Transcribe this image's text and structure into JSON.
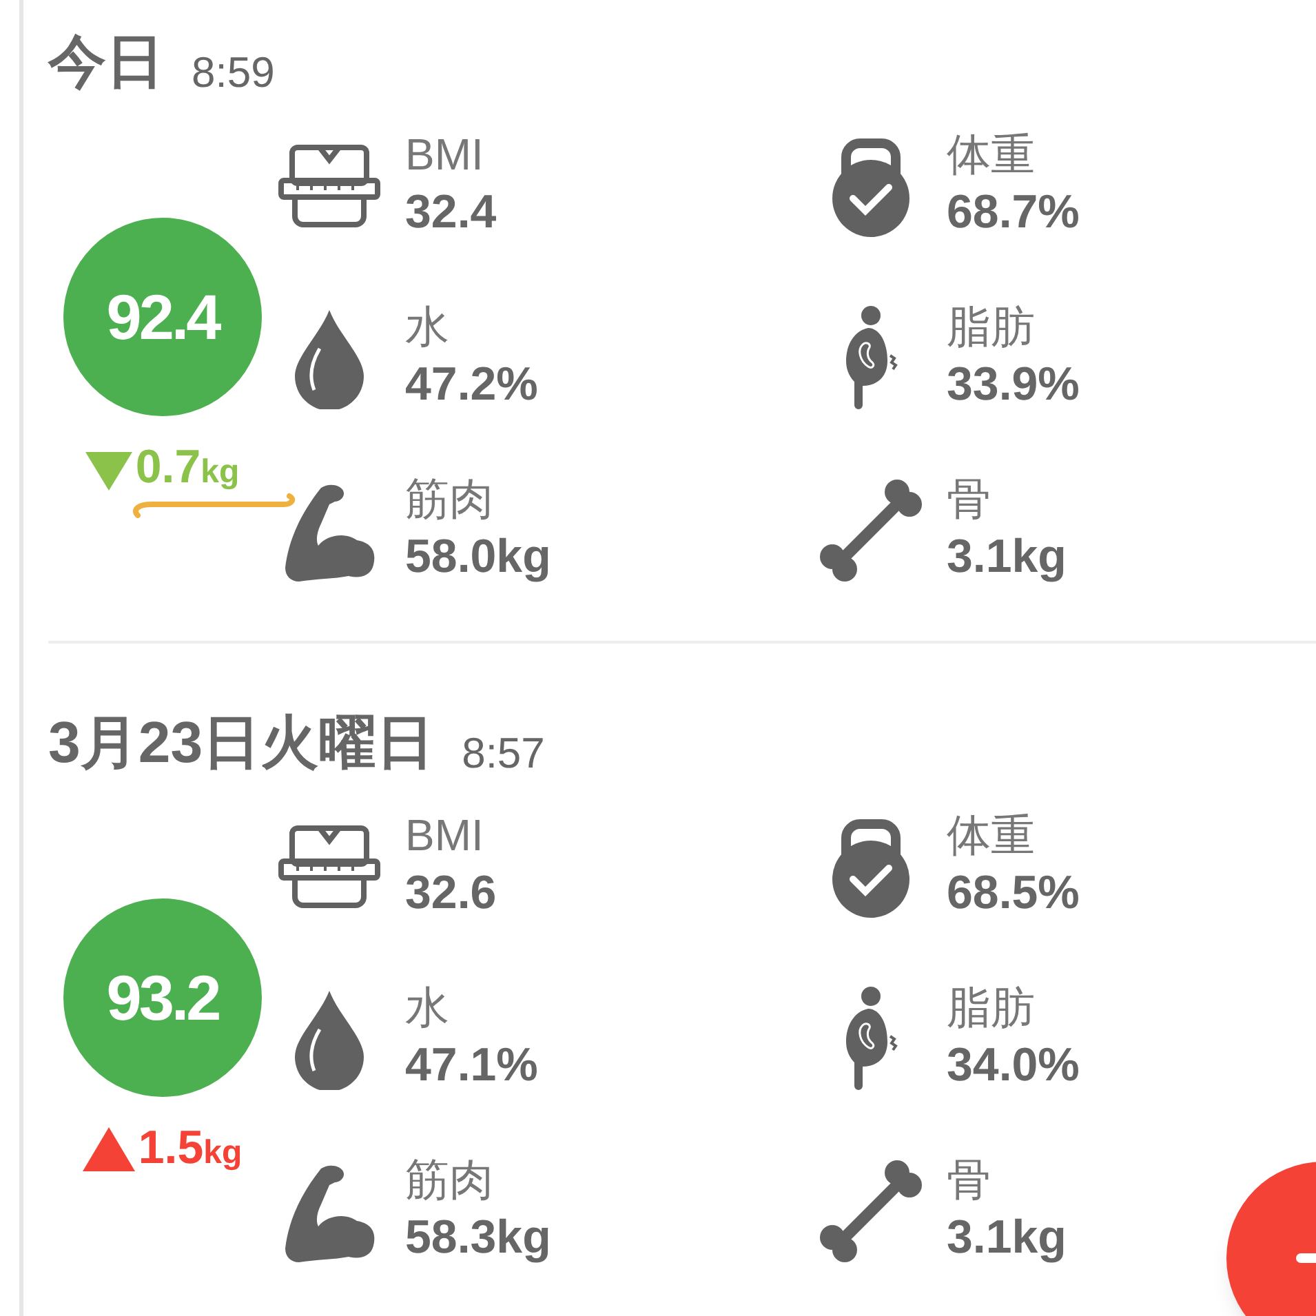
{
  "records": [
    {
      "title": "今日",
      "time": "8:59",
      "score": "92.4",
      "delta": {
        "kind": "down",
        "value": "0.7",
        "unit": "kg"
      },
      "annotated": true,
      "metrics": [
        {
          "kind": "bmi",
          "label": "BMI",
          "value": "32.4"
        },
        {
          "kind": "weight",
          "label": "体重",
          "value": "68.7%"
        },
        {
          "kind": "water",
          "label": "水",
          "value": "47.2%"
        },
        {
          "kind": "fat",
          "label": "脂肪",
          "value": "33.9%"
        },
        {
          "kind": "muscle",
          "label": "筋肉",
          "value": "58.0kg"
        },
        {
          "kind": "bone",
          "label": "骨",
          "value": "3.1kg"
        }
      ]
    },
    {
      "title": "3月23日火曜日",
      "time": "8:57",
      "score": "93.2",
      "delta": {
        "kind": "up",
        "value": "1.5",
        "unit": "kg"
      },
      "annotated": false,
      "metrics": [
        {
          "kind": "bmi",
          "label": "BMI",
          "value": "32.6"
        },
        {
          "kind": "weight",
          "label": "体重",
          "value": "68.5%"
        },
        {
          "kind": "water",
          "label": "水",
          "value": "47.1%"
        },
        {
          "kind": "fat",
          "label": "脂肪",
          "value": "34.0%"
        },
        {
          "kind": "muscle",
          "label": "筋肉",
          "value": "58.3kg"
        },
        {
          "kind": "bone",
          "label": "骨",
          "value": "3.1kg"
        }
      ]
    }
  ]
}
